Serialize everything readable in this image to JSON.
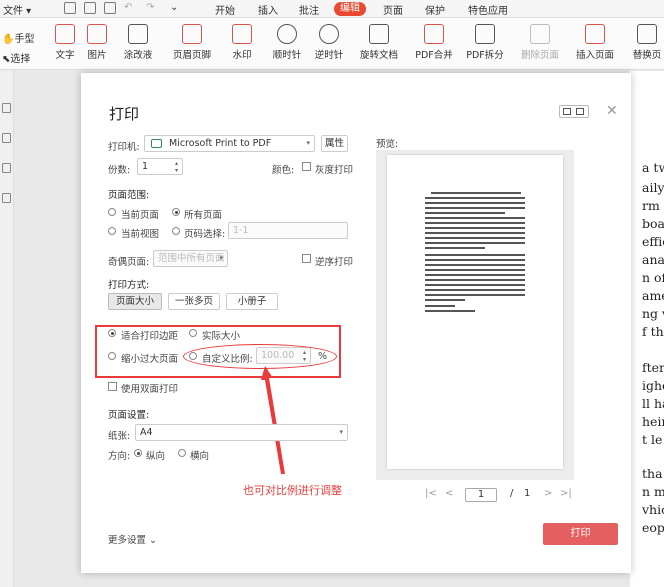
{
  "menubar": {
    "file": "文件",
    "tabs": [
      "开始",
      "插入",
      "批注",
      "编辑",
      "页面",
      "保护",
      "特色应用"
    ],
    "active_tab_index": 3,
    "accent_color": "#e8492f"
  },
  "left_tools": [
    "手型",
    "选择"
  ],
  "ribbon": {
    "items": [
      "文字",
      "图片",
      "涂改液",
      "页眉页脚",
      "水印",
      "顺时针",
      "逆时针",
      "旋转文档",
      "PDF合并",
      "PDF拆分",
      "删除页面",
      "插入页面",
      "替换页"
    ],
    "disabled": [
      "删除页面"
    ]
  },
  "dialog": {
    "title": "打印",
    "printer_label": "打印机:",
    "printer_value": "Microsoft Print to PDF",
    "properties_button": "属性",
    "copies_label": "份数:",
    "copies_value": "1",
    "color_label": "颜色:",
    "grayscale_label": "灰度打印",
    "page_range_label": "页面范围:",
    "range_current_page": "当前页面",
    "range_all_pages": "所有页面",
    "range_current_view": "当前视图",
    "range_page_select": "页码选择:",
    "page_select_placeholder": "1-1",
    "odd_even_label": "奇偶页面:",
    "odd_even_value": "范围中所有页面",
    "reverse_label": "逆序打印",
    "print_mode_label": "打印方式:",
    "mode_buttons": [
      "页面大小",
      "一张多页",
      "小册子"
    ],
    "fit_margins": "适合打印边距",
    "actual_size": "实际大小",
    "shrink_large": "缩小过大页面",
    "custom_scale": "自定义比例:",
    "scale_value": "100.00",
    "percent": "%",
    "duplex_label": "使用双面打印",
    "page_settings_label": "页面设置:",
    "paper_label": "纸张:",
    "paper_value": "A4",
    "orientation_label": "方向:",
    "portrait": "纵向",
    "landscape": "横向",
    "more_settings": "更多设置",
    "preview_label": "预览:",
    "page_current": "1",
    "page_sep": "/",
    "page_total": "1",
    "print_button": "打印",
    "print_button_color": "#e45f5f"
  },
  "annotation": {
    "text": "也可对比例进行调整",
    "color": "#e83c3c"
  },
  "doc_snippets": [
    "a tw",
    "aily",
    "rm c",
    "boa",
    "effic",
    "ana",
    "n of",
    "ame",
    "ng v",
    "f th",
    "fter",
    "ighe",
    "ll ha",
    "heir",
    "t le",
    "tha",
    "n m",
    "vhic",
    "eop"
  ]
}
